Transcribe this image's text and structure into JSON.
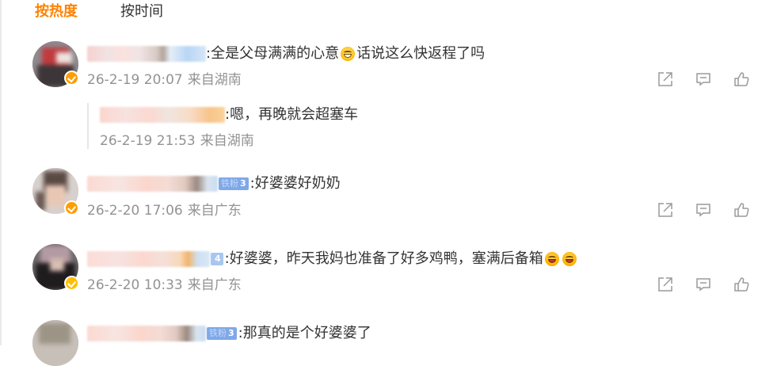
{
  "sort": {
    "tabs": [
      {
        "label": "按热度",
        "active": true
      },
      {
        "label": "按时间",
        "active": false
      }
    ]
  },
  "colors": {
    "accent": "#ff8200",
    "meta_text": "#939393",
    "body_text": "#333333",
    "fan_badge": "#7fa8e8"
  },
  "comments": [
    {
      "text": ":全是父母满满的心意😁话说这么快返程了吗",
      "text_parts": [
        ":全是父母满满的心意",
        "话说这么快返程了吗"
      ],
      "time": "26-2-19 20:07",
      "location": "来自湖南",
      "badge": "verified-orange",
      "reply": {
        "text": ":嗯，再晚就会超塞车",
        "time": "26-2-19 21:53",
        "location": "来自湖南"
      }
    },
    {
      "fan_badge_text": "铁粉",
      "fan_level": "3",
      "text": ":好婆婆好奶奶",
      "time": "26-2-20 17:06",
      "location": "来自广东",
      "badge": "verified-orange"
    },
    {
      "fan_level": "4",
      "text": ":好婆婆，昨天我妈也准备了好多鸡鸭，塞满后备箱😆😆",
      "text_main": ":好婆婆，昨天我妈也准备了好多鸡鸭，塞满后备箱",
      "time": "26-2-20 10:33",
      "location": "来自广东",
      "badge": "verified-gold"
    },
    {
      "fan_badge_text": "铁粉",
      "fan_level": "3",
      "text": ":那真的是个好婆婆了"
    }
  ],
  "action_icons": [
    "share-icon",
    "comment-icon",
    "like-icon"
  ]
}
